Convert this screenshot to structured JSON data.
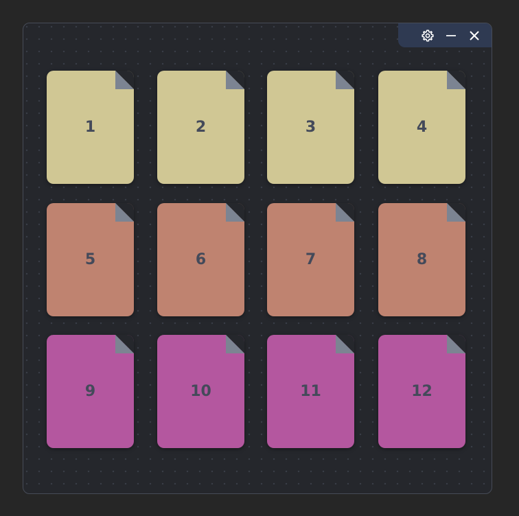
{
  "window": {
    "controls": {
      "settings_icon": "gear-icon",
      "minimize_icon": "minimize-icon",
      "close_icon": "close-icon"
    }
  },
  "colors": {
    "row1": "#d0c794",
    "row2": "#bf8370",
    "row3": "#b4579f",
    "titlebar": "#2f3a52"
  },
  "files": [
    {
      "label": "1"
    },
    {
      "label": "2"
    },
    {
      "label": "3"
    },
    {
      "label": "4"
    },
    {
      "label": "5"
    },
    {
      "label": "6"
    },
    {
      "label": "7"
    },
    {
      "label": "8"
    },
    {
      "label": "9"
    },
    {
      "label": "10"
    },
    {
      "label": "11"
    },
    {
      "label": "12"
    }
  ]
}
